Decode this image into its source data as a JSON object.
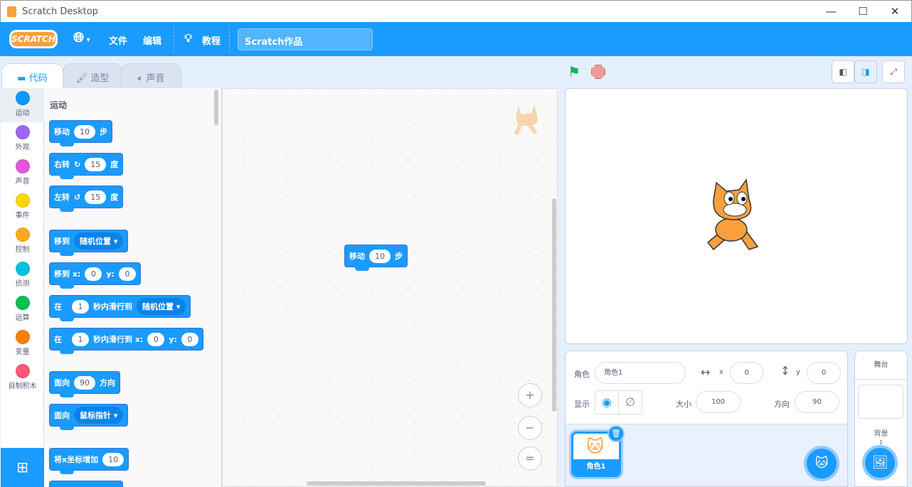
{
  "window": {
    "title": "Scratch Desktop",
    "minimize": "—",
    "maximize": "☐",
    "close": "✕"
  },
  "menu": {
    "logo": "SCRATCH",
    "language_icon": "globe-icon",
    "file": "文件",
    "edit": "编辑",
    "tutorials": "教程",
    "project_name": "Scratch作品"
  },
  "tabs": [
    {
      "label": "代码"
    },
    {
      "label": "造型"
    },
    {
      "label": "声音"
    }
  ],
  "categories": [
    {
      "label": "运动",
      "color": "#4c97ff"
    },
    {
      "label": "外观",
      "color": "#9966ff"
    },
    {
      "label": "声音",
      "color": "#cf63cf"
    },
    {
      "label": "事件",
      "color": "#ffd500"
    },
    {
      "label": "控制",
      "color": "#ffab19"
    },
    {
      "label": "侦测",
      "color": "#5cb1d6"
    },
    {
      "label": "运算",
      "color": "#59c059"
    },
    {
      "label": "变量",
      "color": "#ff8c1a"
    },
    {
      "label": "自制积木",
      "color": "#ff6680"
    }
  ],
  "palette": {
    "heading": "运动",
    "blocks": {
      "move": {
        "a": "移动",
        "v": "10",
        "b": "步"
      },
      "turn_right": {
        "a": "右转",
        "icon": "↻",
        "v": "15",
        "b": "度"
      },
      "turn_left": {
        "a": "左转",
        "icon": "↺",
        "v": "15",
        "b": "度"
      },
      "goto": {
        "a": "移到",
        "dd": "随机位置 ▾"
      },
      "goto_xy": {
        "a": "移到 x:",
        "x": "0",
        "y_label": "y:",
        "y": "0"
      },
      "glide": {
        "a": "在",
        "v": "1",
        "b": "秒内滑行到",
        "dd": "随机位置 ▾"
      },
      "glide_xy": {
        "a": "在",
        "v": "1",
        "b": "秒内滑行到 x:",
        "x": "0",
        "y_label": "y:",
        "y": "0"
      },
      "point": {
        "a": "面向",
        "v": "90",
        "b": "方向"
      },
      "point_towards": {
        "a": "面向",
        "dd": "鼠标指针 ▾"
      },
      "change_x": {
        "a": "将x坐标增加",
        "v": "10"
      }
    }
  },
  "script": {
    "a": "移动",
    "v": "10",
    "b": "步"
  },
  "zoom": {
    "in": "+",
    "out": "−",
    "reset": "="
  },
  "sprite_info": {
    "sprite_label": "角色",
    "sprite_name": "角色1",
    "x_label": "x",
    "x": "0",
    "y_label": "y",
    "y": "0",
    "show_label": "显示",
    "size_label": "大小",
    "size": "100",
    "direction_label": "方向",
    "direction": "90"
  },
  "sprites": [
    {
      "name": "角色1"
    }
  ],
  "stage_panel": {
    "title": "舞台",
    "backdrops_label": "背景",
    "backdrop_count": "1"
  }
}
